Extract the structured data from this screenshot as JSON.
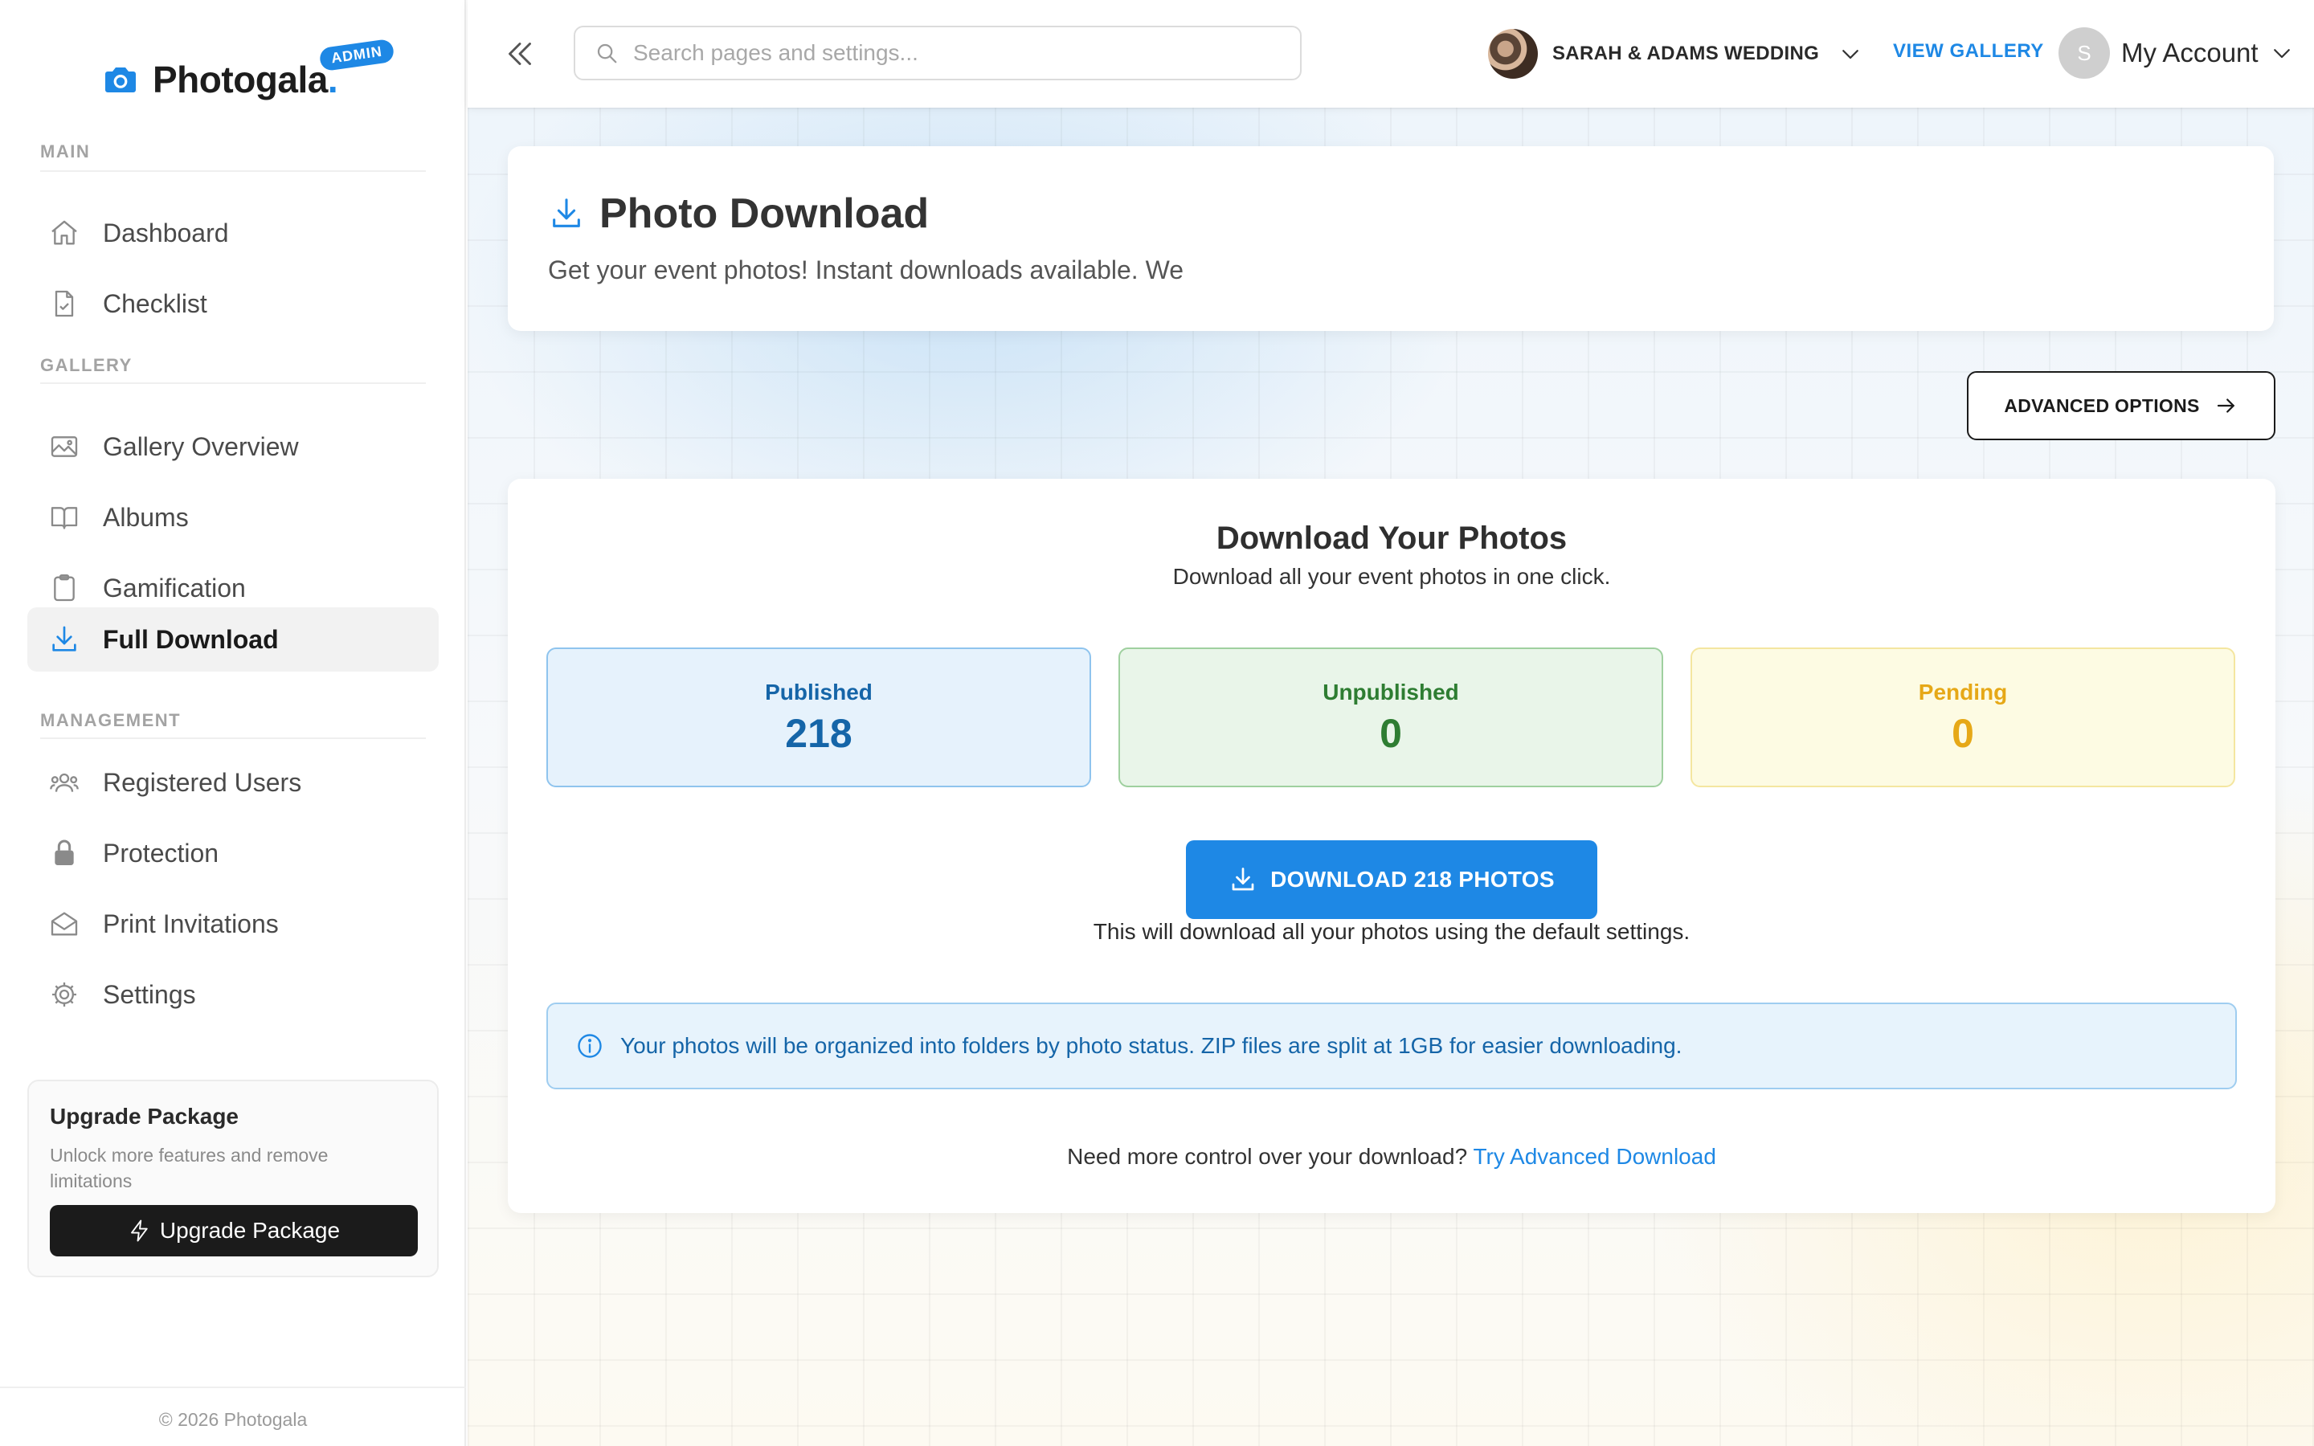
{
  "app": {
    "name": "Photogala",
    "badge": "ADMIN",
    "accent": "#1e88e5"
  },
  "sidebar": {
    "sections": [
      {
        "label": "MAIN"
      },
      {
        "label": "GALLERY"
      },
      {
        "label": "MANAGEMENT"
      }
    ],
    "items": [
      {
        "label": "Dashboard",
        "icon": "home-icon"
      },
      {
        "label": "Checklist",
        "icon": "file-check-icon"
      },
      {
        "label": "Gallery Overview",
        "icon": "image-icon"
      },
      {
        "label": "Albums",
        "icon": "book-icon"
      },
      {
        "label": "Gamification",
        "icon": "clipboard-icon"
      },
      {
        "label": "Full Download",
        "icon": "download-icon",
        "active": true
      },
      {
        "label": "Registered Users",
        "icon": "users-icon"
      },
      {
        "label": "Protection",
        "icon": "lock-icon"
      },
      {
        "label": "Print Invitations",
        "icon": "envelope-icon"
      },
      {
        "label": "Settings",
        "icon": "gear-icon"
      }
    ],
    "upgrade": {
      "title": "Upgrade Package",
      "description": "Unlock more features and remove limitations",
      "button": "Upgrade Package"
    },
    "copyright": "© 2026 Photogala"
  },
  "topbar": {
    "search_placeholder": "Search pages and settings...",
    "event_name": "SARAH & ADAMS WEDDING",
    "view_gallery": "VIEW GALLERY",
    "account_initial": "S",
    "account_label": "My Account"
  },
  "header": {
    "title": "Photo Download",
    "subtitle": "Get your event photos! Instant downloads available. We"
  },
  "advanced_button": "ADVANCED OPTIONS",
  "download": {
    "title": "Download Your Photos",
    "subtitle": "Download all your event photos in one click.",
    "stats": [
      {
        "label": "Published",
        "value": "218",
        "color": "#1565a8"
      },
      {
        "label": "Unpublished",
        "value": "0",
        "color": "#2e7d32"
      },
      {
        "label": "Pending",
        "value": "0",
        "color": "#e6a817"
      }
    ],
    "button": "DOWNLOAD 218 PHOTOS",
    "note": "This will download all your photos using the default settings.",
    "info": "Your photos will be organized into folders by photo status. ZIP files are split at 1GB for easier downloading.",
    "more_prefix": "Need more control over your download?",
    "more_link": "Try Advanced Download"
  }
}
